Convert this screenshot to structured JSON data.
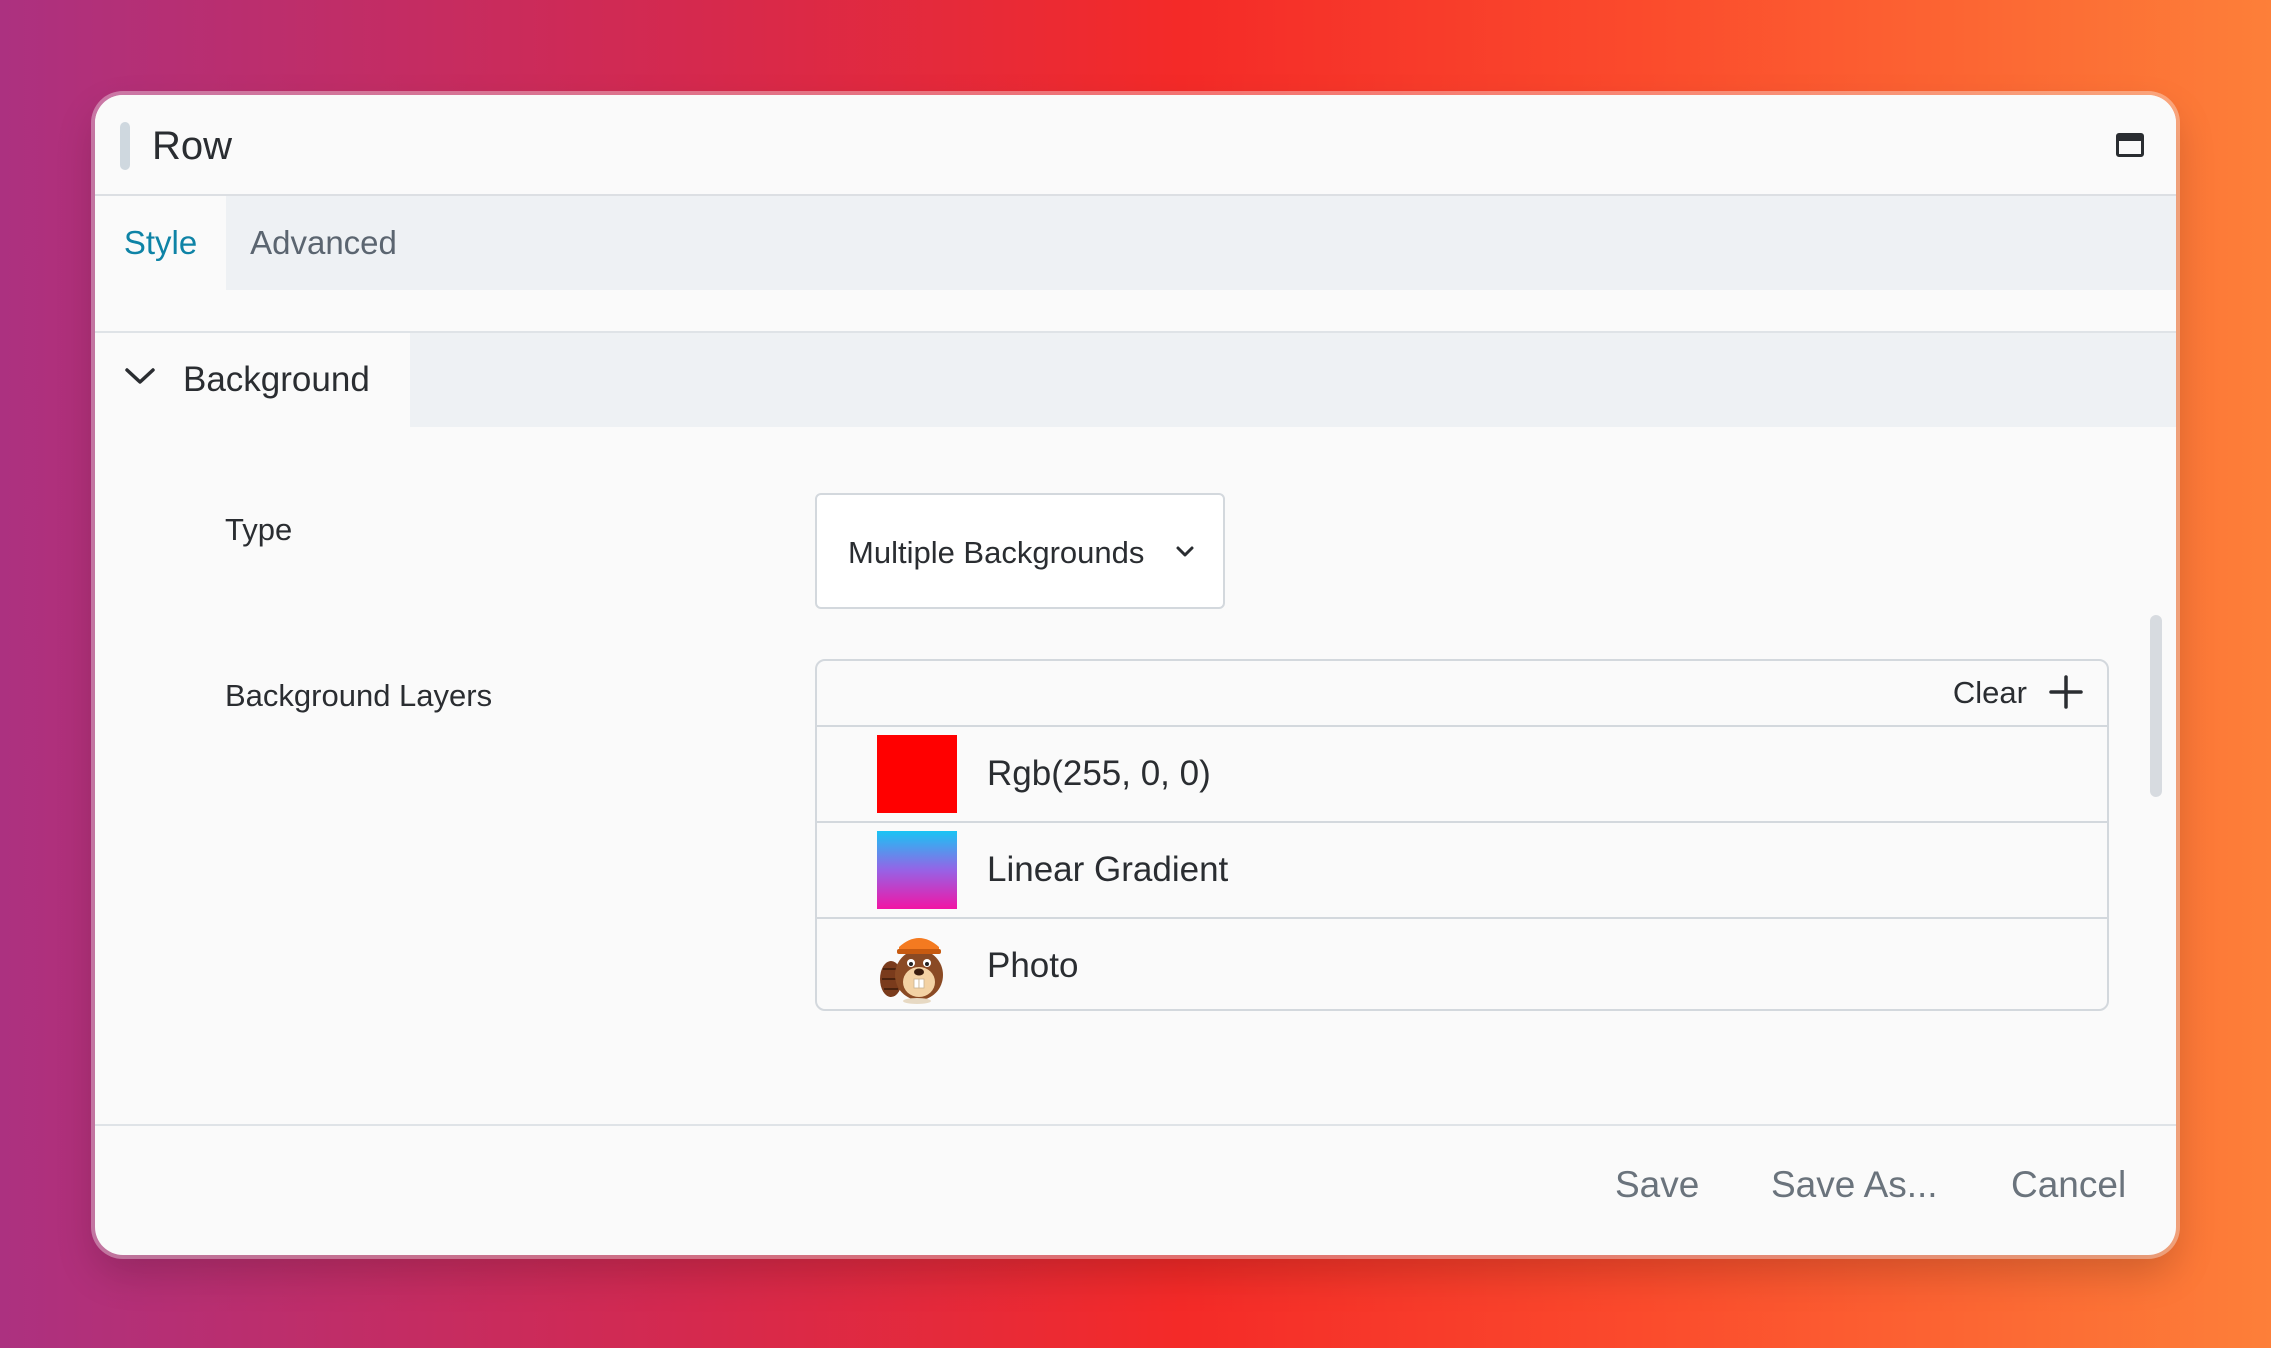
{
  "window": {
    "title": "Row"
  },
  "tabs": [
    {
      "label": "Style",
      "active": true
    },
    {
      "label": "Advanced",
      "active": false
    }
  ],
  "section": {
    "title": "Background",
    "expanded": true
  },
  "type_field": {
    "label": "Type",
    "value": "Multiple Backgrounds"
  },
  "layers_field": {
    "label": "Background Layers",
    "clear_label": "Clear",
    "items": [
      {
        "label": "Rgb(255, 0, 0)",
        "swatch": "color",
        "color": "#ff0000"
      },
      {
        "label": "Linear Gradient",
        "swatch": "gradient",
        "colors": [
          "#19c4f4",
          "#f215a4"
        ]
      },
      {
        "label": "Photo",
        "swatch": "photo",
        "icon": "beaver-mascot-icon"
      }
    ]
  },
  "footer": {
    "save_label": "Save",
    "save_as_label": "Save As...",
    "cancel_label": "Cancel"
  },
  "colors": {
    "accent": "#0e83a6",
    "tab_bg": "#eef1f4",
    "window_bg": "#fafafa"
  }
}
